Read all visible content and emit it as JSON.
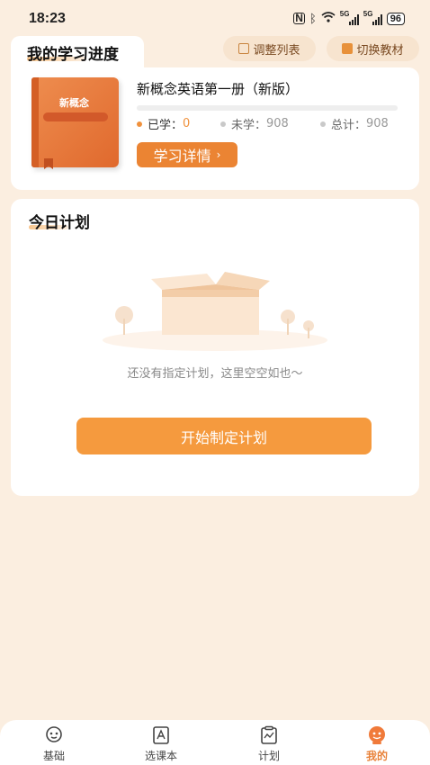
{
  "status_bar": {
    "time": "18:23",
    "network_label_1": "5G",
    "network_label_2": "5G",
    "battery": "96"
  },
  "progress": {
    "section_title": "我的学习进度",
    "adjust_list_label": "调整列表",
    "switch_textbook_label": "切换教材",
    "book_cover_text": "新概念",
    "course_name": "新概念英语第一册（新版）",
    "learned_label": "已学：",
    "learned_value": "0",
    "unlearned_label": "未学：",
    "unlearned_value": "908",
    "total_label": "总计：",
    "total_value": "908",
    "progress_fraction": 0,
    "detail_button_label": "学习详情"
  },
  "today_plan": {
    "section_title": "今日计划",
    "empty_text": "还没有指定计划，这里空空如也～",
    "start_button_label": "开始制定计划"
  },
  "tabs": [
    {
      "label": "基础",
      "icon": "basics-icon",
      "active": false
    },
    {
      "label": "选课本",
      "icon": "textbook-icon",
      "active": false
    },
    {
      "label": "计划",
      "icon": "plan-icon",
      "active": false
    },
    {
      "label": "我的",
      "icon": "profile-icon",
      "active": true
    }
  ],
  "colors": {
    "accent": "#eb8433",
    "background": "#fbeee0"
  }
}
